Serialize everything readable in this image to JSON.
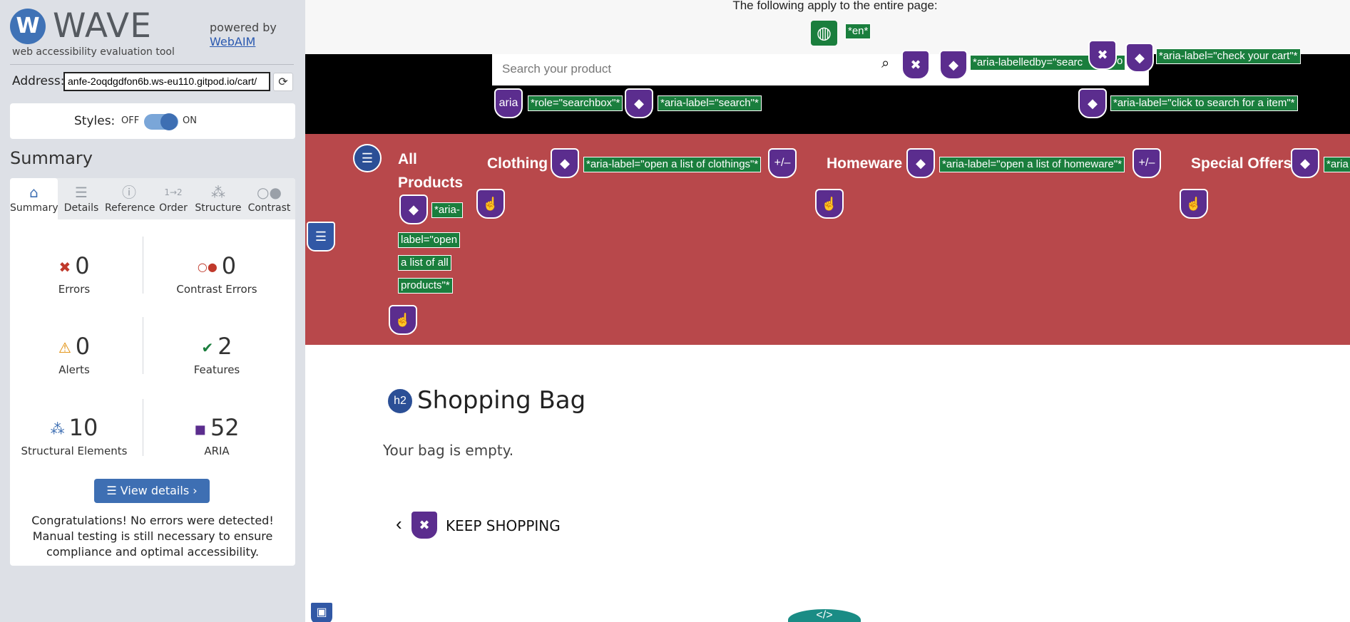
{
  "wave": {
    "logo_letter": "W",
    "logo_text": "WAVE",
    "subtitle": "web accessibility evaluation tool",
    "powered_by": "powered by",
    "webaim_link": "WebAIM",
    "address_label": "Address:",
    "address_value": "anfe-2oqdgdfon6b.ws-eu110.gitpod.io/cart/",
    "styles_label": "Styles:",
    "styles_off": "OFF",
    "styles_on": "ON",
    "summary_title": "Summary",
    "tabs": [
      {
        "label": "Summary",
        "icon": "home-icon"
      },
      {
        "label": "Details",
        "icon": "list-icon"
      },
      {
        "label": "Reference",
        "icon": "info-icon"
      },
      {
        "label": "Order",
        "icon": "order-icon"
      },
      {
        "label": "Structure",
        "icon": "structure-icon"
      },
      {
        "label": "Contrast",
        "icon": "contrast-icon"
      }
    ],
    "active_tab": "Summary",
    "stats": {
      "errors": {
        "value": "0",
        "label": "Errors"
      },
      "contrast_errors": {
        "value": "0",
        "label": "Contrast Errors"
      },
      "alerts": {
        "value": "0",
        "label": "Alerts"
      },
      "features": {
        "value": "2",
        "label": "Features"
      },
      "structural": {
        "value": "10",
        "label": "Structural Elements"
      },
      "aria": {
        "value": "52",
        "label": "ARIA"
      }
    },
    "view_details": "View details ›",
    "congrats": "Congratulations! No errors were detected! Manual testing is still necessary to ensure compliance and optimal accessibility.",
    "colors": {
      "accent": "#3e6fb3",
      "error": "#c0392b",
      "alert": "#e08a00",
      "feature": "#1a7e3d",
      "aria": "#5b2d8e"
    }
  },
  "page": {
    "banner_text": "The following apply to the entire page:",
    "lang_tag": "*en*",
    "search_placeholder": "Search your product",
    "tags": {
      "labelledby": "*aria-labelledby=\"searc",
      "labelledby_tail": "o",
      "check_cart": "*aria-label=\"check your cart\"*",
      "role_searchbox": "*role=\"searchbox\"*",
      "label_search": "*aria-label=\"search\"*",
      "label_click_search": "*aria-label=\"click to search for a item\"*",
      "label_clothings": "*aria-label=\"open a list of clothings\"*",
      "label_homeware": "*aria-label=\"open a list of homeware\"*",
      "label_special": "*aria",
      "label_all_1": "*aria-",
      "label_all_2": "label=\"open",
      "label_all_3": "a list of all",
      "label_all_4": "products\"*"
    },
    "aria_badge_text": "aria",
    "plusminus": "+/–",
    "nav": {
      "all_products_1": "All",
      "all_products_2": "Products",
      "clothing": "Clothing",
      "homeware": "Homeware",
      "special_offers": "Special Offers"
    },
    "h2_badge": "h2",
    "heading": "Shopping Bag",
    "empty": "Your bag is empty.",
    "keep_shopping": "KEEP SHOPPING",
    "chevron": "‹",
    "bottom_code": "</>",
    "colors": {
      "nav_red": "#b8484b",
      "header_black": "#000000",
      "tag_green": "#1a7e3d"
    }
  }
}
